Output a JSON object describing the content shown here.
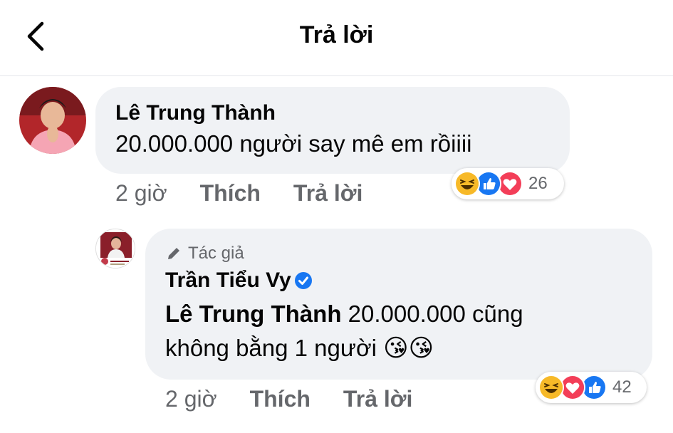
{
  "header": {
    "title": "Trả lời",
    "back_icon": "chevron-left-icon"
  },
  "comment": {
    "author": "Lê Trung Thành",
    "text": "20.000.000 người say mê em rồiiii",
    "time": "2 giờ",
    "like_label": "Thích",
    "reply_label": "Trả lời",
    "reactions": [
      "haha",
      "like",
      "love"
    ],
    "reaction_count": "26"
  },
  "reply": {
    "author_badge": "Tác giả",
    "author": "Trần Tiểu Vy",
    "verified": true,
    "mention": "Lê Trung Thành",
    "text_line1": " 20.000.000 cũng",
    "text_line2": "không bằng 1 người ",
    "emoji": "😘😘",
    "time": "2 giờ",
    "like_label": "Thích",
    "reply_label": "Trả lời",
    "reactions": [
      "haha",
      "love",
      "like"
    ],
    "reaction_count": "42"
  },
  "colors": {
    "bubble_bg": "#f0f2f5",
    "meta_text": "#65676b",
    "like_blue": "#1877f2",
    "love_red": "#f33e58",
    "haha_yellow": "#f7b928"
  }
}
